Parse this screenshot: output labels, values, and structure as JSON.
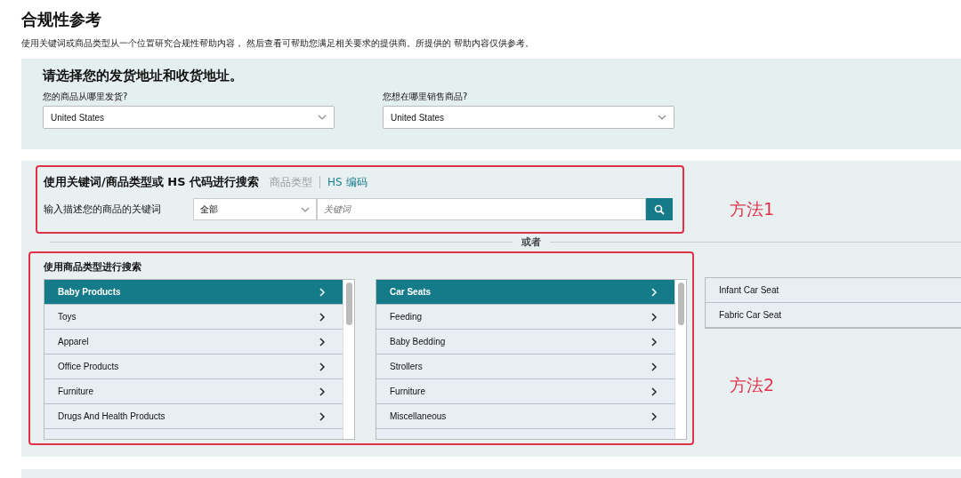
{
  "page": {
    "title": "合规性参考",
    "description": "使用关键词或商品类型从一个位置研究合规性帮助内容， 然后查看可帮助您满足相关要求的提供商。所提供的 帮助内容仅供参考。"
  },
  "address_panel": {
    "title": "请选择您的发货地址和收货地址。",
    "fields": [
      {
        "label": "您的商品从哪里发货?",
        "value": "United States"
      },
      {
        "label": "您想在哪里销售商品?",
        "value": "United States"
      }
    ]
  },
  "keyword_search": {
    "title": "使用关键词/商品类型或 HS 代码进行搜索",
    "tabs": [
      {
        "label": "商品类型",
        "selected": false
      },
      {
        "label": "HS 编码",
        "selected": true
      }
    ],
    "label": "输入描述您的商品的关键词",
    "category": "全部",
    "placeholder": "关键词",
    "annotation": "方法1"
  },
  "divider_text": "或者",
  "category_search": {
    "title": "使用商品类型进行搜索",
    "annotation": "方法2",
    "lists": [
      {
        "scrollable": true,
        "items": [
          {
            "label": "Baby Products",
            "selected": true
          },
          {
            "label": "Toys",
            "selected": false
          },
          {
            "label": "Apparel",
            "selected": false
          },
          {
            "label": "Office Products",
            "selected": false
          },
          {
            "label": "Furniture",
            "selected": false
          },
          {
            "label": "Drugs And Health Products",
            "selected": false
          }
        ]
      },
      {
        "scrollable": true,
        "items": [
          {
            "label": "Car Seats",
            "selected": true
          },
          {
            "label": "Feeding",
            "selected": false
          },
          {
            "label": "Baby Bedding",
            "selected": false
          },
          {
            "label": "Strollers",
            "selected": false
          },
          {
            "label": "Furniture",
            "selected": false
          },
          {
            "label": "Miscellaneous",
            "selected": false
          }
        ]
      },
      {
        "scrollable": false,
        "items": [
          {
            "label": "Infant Car Seat",
            "selected": false
          },
          {
            "label": "Fabric Car Seat",
            "selected": false
          }
        ]
      }
    ]
  }
}
